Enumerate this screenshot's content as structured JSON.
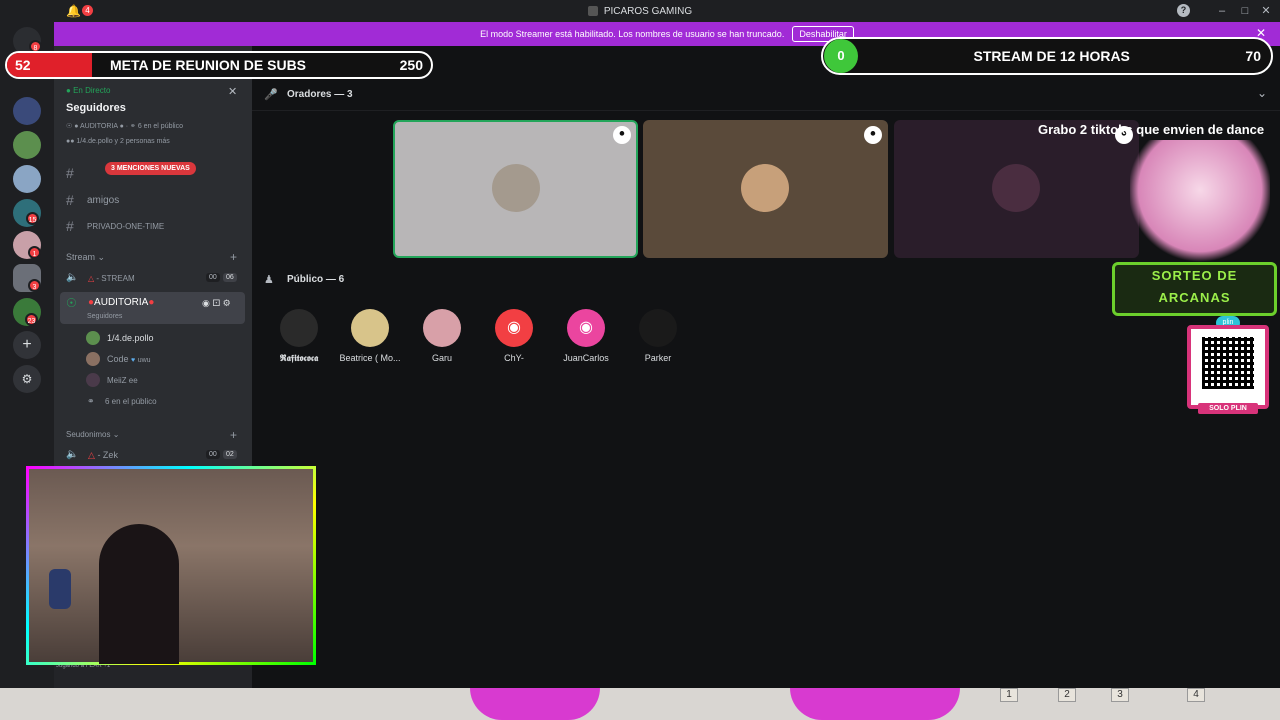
{
  "titlebar": {
    "title": "PICAROS GAMING",
    "bell_badge": "4",
    "help": "?"
  },
  "banner": {
    "text": "El modo Streamer está habilitado. Los nombres de usuario se han truncado.",
    "button": "Deshabilitar"
  },
  "overlay": {
    "subs_current": "52",
    "subs_label": "META DE REUNION DE SUBS",
    "subs_goal": "250",
    "hours_current": "0",
    "hours_label": "STREAM DE 12 HORAS",
    "hours_goal": "70",
    "tiktok_text": "Grabo 2 tiktoks que envien de dance",
    "sorteo_text": "SORTEO DE ARCANAS",
    "solo_plin": "SOLO PLIN",
    "plin": "plin"
  },
  "rail": {
    "badges": [
      "8",
      "15",
      "1",
      "3",
      "23"
    ]
  },
  "sidebar": {
    "live_label": "En Directo",
    "stage_title": "Seguidores",
    "stage_channel": "AUDITORIA",
    "stage_public": "6 en el público",
    "stage_people": "1/4.de.pollo y 2 personas más",
    "mentions_badge": "3 MENCIONES NUEVAS",
    "channels": [
      "amigos",
      "PRIVADO-ONE-TIME"
    ],
    "cat_stream": "Stream",
    "stream_channel": "- STREAM",
    "stream_counts": [
      "00",
      "06"
    ],
    "auditoria": "AUDITORIA",
    "auditoria_sub": "Seguidores",
    "members": [
      "1/4.de.pollo",
      "Code",
      "MeiiZ ee"
    ],
    "member_tag": "uwu",
    "public_count": "6 en el público",
    "cat_seudonimos": "Seudonimos",
    "zek_channel": "- Zek",
    "zek_counts": [
      "00",
      "02"
    ],
    "footer_status": "Jugando a FEAR +1"
  },
  "main": {
    "speakers_label": "Oradores — 3",
    "public_label": "Público — 6",
    "audience": [
      "𝕽𝖆𝖋𝖎𝖙𝖔𝖈𝖔𝖈𝖆",
      "Beatrice ( Mo...",
      "Garu",
      "ChY-",
      "JuanCarlos",
      "Parker"
    ]
  },
  "keys": [
    "1",
    "2",
    "3",
    "4"
  ],
  "colors": {
    "accent": "#5865f2",
    "banner": "#a12bd6",
    "danger": "#f23f43",
    "live": "#23a55a"
  }
}
